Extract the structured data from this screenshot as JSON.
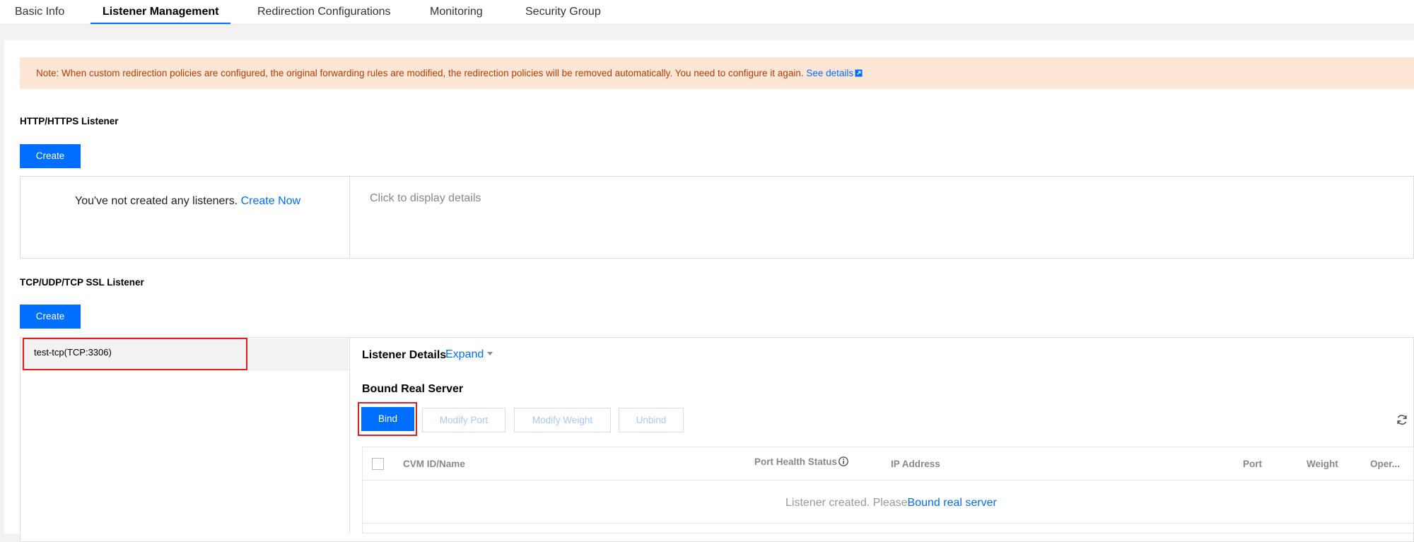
{
  "tabs": [
    {
      "label": "Basic Info"
    },
    {
      "label": "Listener Management"
    },
    {
      "label": "Redirection Configurations"
    },
    {
      "label": "Monitoring"
    },
    {
      "label": "Security Group"
    }
  ],
  "notice": {
    "text": "Note: When custom redirection policies are configured, the original forwarding rules are modified, the redirection policies will be removed automatically. You need to configure it again. ",
    "link": "See details"
  },
  "http_section": {
    "title": "HTTP/HTTPS Listener",
    "create_label": "Create",
    "empty_text": "You've not created any listeners. ",
    "create_now_link": "Create Now",
    "details_placeholder": "Click to display details"
  },
  "tcp_section": {
    "title": "TCP/UDP/TCP SSL Listener",
    "create_label": "Create",
    "listeners": [
      {
        "label": "test-tcp(TCP:3306)"
      }
    ],
    "details_title": "Listener Details",
    "expand_label": "Expand",
    "bound_title": "Bound Real Server",
    "buttons": {
      "bind": "Bind",
      "modify_port": "Modify Port",
      "modify_weight": "Modify Weight",
      "unbind": "Unbind"
    },
    "table": {
      "columns": [
        "CVM ID/Name",
        "Port Health Status",
        "IP Address",
        "Port",
        "Weight",
        "Oper..."
      ],
      "empty_text": "Listener created. Please",
      "empty_link": "Bound real server"
    }
  },
  "colors": {
    "primary": "#006eff",
    "notice_bg": "#fde6d6",
    "notice_text": "#b43e05",
    "highlight": "#e02020"
  }
}
